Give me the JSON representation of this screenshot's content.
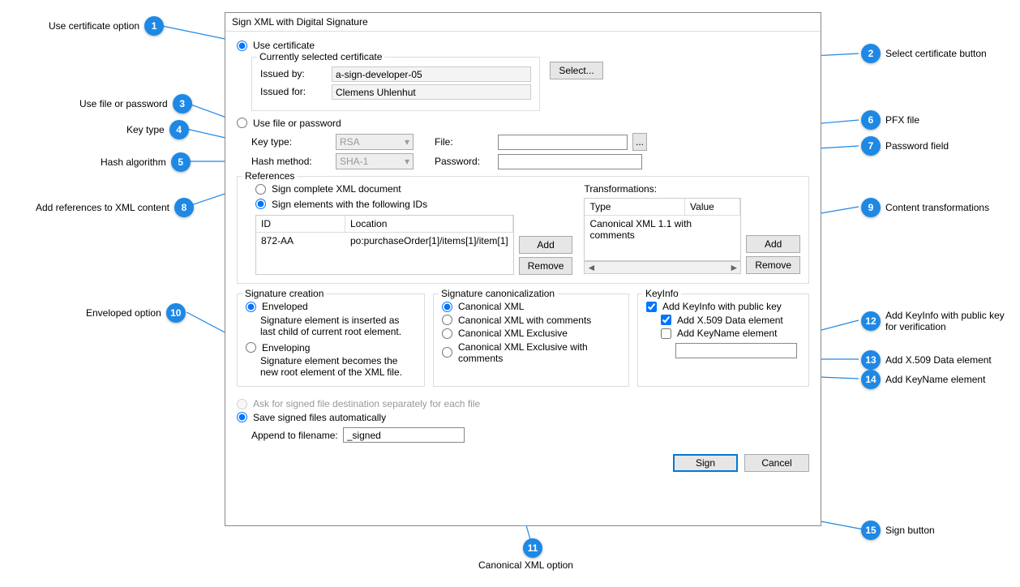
{
  "dialog": {
    "title": "Sign XML with Digital Signature",
    "use_certificate": "Use certificate",
    "cert_legend": "Currently selected certificate",
    "issued_by_lbl": "Issued by:",
    "issued_by_val": "a-sign-developer-05",
    "issued_for_lbl": "Issued for:",
    "issued_for_val": "Clemens Uhlenhut",
    "select_btn": "Select...",
    "use_file_pwd": "Use file or password",
    "key_type_lbl": "Key type:",
    "key_type_val": "RSA",
    "hash_method_lbl": "Hash method:",
    "hash_method_val": "SHA-1",
    "file_lbl": "File:",
    "password_lbl": "Password:",
    "refs_legend": "References",
    "sign_complete": "Sign complete XML document",
    "sign_ids": "Sign elements with the following IDs",
    "id_hdr": "ID",
    "loc_hdr": "Location",
    "id_val": "872-AA",
    "loc_val": "po:purchaseOrder[1]/items[1]/item[1]",
    "add_btn": "Add",
    "remove_btn": "Remove",
    "trans_lbl": "Transformations:",
    "trans_type_hdr": "Type",
    "trans_value_hdr": "Value",
    "trans_row1": "Canonical XML 1.1 with comments",
    "sigcreate_legend": "Signature creation",
    "enveloped": "Enveloped",
    "enveloped_desc": "Signature element is inserted as last child of current root element.",
    "enveloping": "Enveloping",
    "enveloping_desc": "Signature element becomes the new root element of the XML file.",
    "canon_legend": "Signature canonicalization",
    "canon_xml": "Canonical XML",
    "canon_xml_c": "Canonical XML with comments",
    "canon_xml_e": "Canonical XML Exclusive",
    "canon_xml_ec": "Canonical XML Exclusive with comments",
    "keyinfo_legend": "KeyInfo",
    "add_keyinfo": "Add KeyInfo with public key",
    "add_x509": "Add X.509 Data element",
    "add_keyname": "Add KeyName element",
    "ask_dest": "Ask for signed file destination separately for each file",
    "save_auto": "Save signed files automatically",
    "append_lbl": "Append to filename:",
    "append_val": "_signed",
    "sign_btn": "Sign",
    "cancel_btn": "Cancel"
  },
  "callouts": {
    "c1": "Use certificate option",
    "c2": "Select certificate button",
    "c3": "Use file or password",
    "c4": "Key type",
    "c5": "Hash algorithm",
    "c6": "PFX file",
    "c7": "Password field",
    "c8": "Add references to XML content",
    "c9": "Content transformations",
    "c10": "Enveloped option",
    "c11": "Canonical XML option",
    "c12": "Add KeyInfo with public key for verification",
    "c13": "Add X.509 Data element",
    "c14": "Add KeyName element",
    "c15": "Sign button"
  }
}
